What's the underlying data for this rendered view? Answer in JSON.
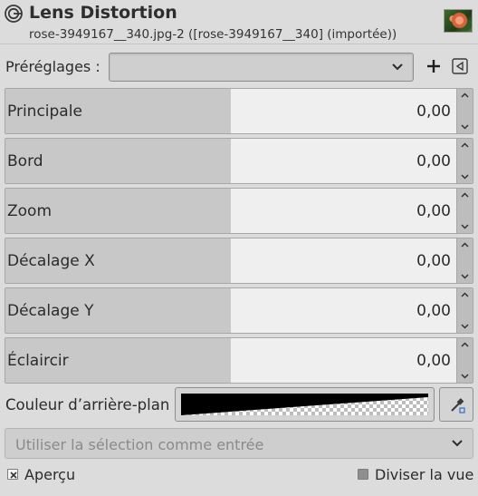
{
  "header": {
    "title": "Lens Distortion",
    "subtitle": "rose-3949167__340.jpg-2 ([rose-3949167__340] (importée))",
    "icon": "gimp-logo-icon",
    "thumbnail": "image-thumbnail-rose"
  },
  "presets": {
    "label": "Préréglages :",
    "value": "",
    "add_icon": "plus-icon",
    "menu_icon": "menu-arrow-icon"
  },
  "sliders": [
    {
      "label": "Principale",
      "value": "0,00",
      "fraction": 0.5
    },
    {
      "label": "Bord",
      "value": "0,00",
      "fraction": 0.5
    },
    {
      "label": "Zoom",
      "value": "0,00",
      "fraction": 0.5
    },
    {
      "label": "Décalage X",
      "value": "0,00",
      "fraction": 0.5
    },
    {
      "label": "Décalage Y",
      "value": "0,00",
      "fraction": 0.5
    },
    {
      "label": "Éclaircir",
      "value": "0,00",
      "fraction": 0.5
    }
  ],
  "background_color": {
    "label": "Couleur d’arrière-plan",
    "color": "#000000",
    "picker_icon": "color-picker-icon"
  },
  "selection_input": {
    "value": "Utiliser la sélection comme entrée"
  },
  "preview": {
    "label": "Aperçu",
    "checked": true
  },
  "split_view": {
    "label": "Diviser la vue",
    "checked": false
  }
}
